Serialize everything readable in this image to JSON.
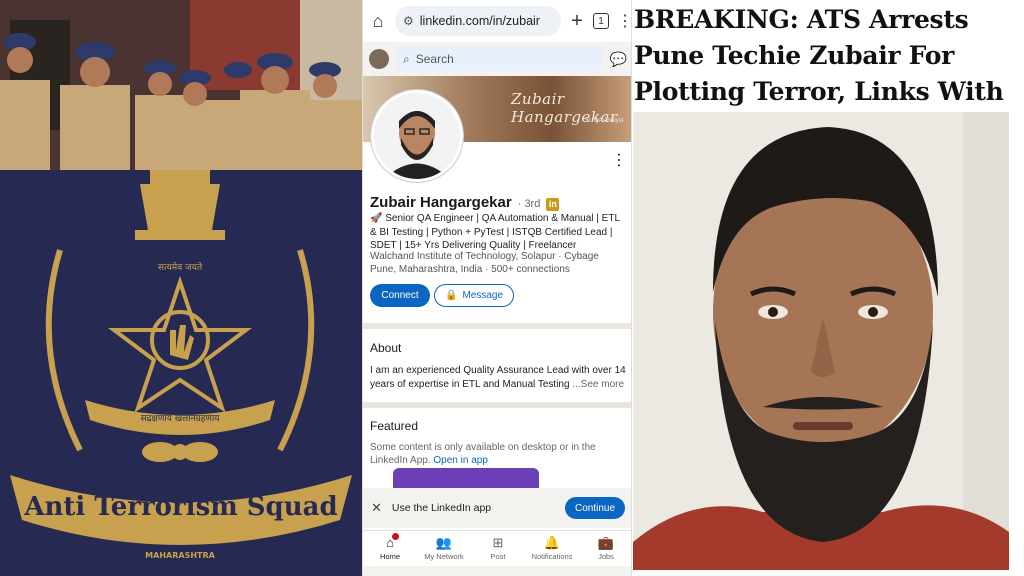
{
  "left": {
    "emblem": {
      "motto": "सत्यमेव जयते",
      "scroll_text": "सद्रक्षणाय खलनिग्रहणाय",
      "banner_text": "Anti Terrorism Squad",
      "state": "MAHARASHTRA"
    }
  },
  "browser": {
    "url": "linkedin.com/in/zubair",
    "tab_count": "1",
    "home_icon": "home-icon",
    "menu_icon": "kebab-icon"
  },
  "linkedin": {
    "search_placeholder": "Search",
    "banner_signature": "Zubair Hangargekar",
    "banner_role": "Sr. QA Analyst",
    "profile": {
      "name": "Zubair Hangargekar",
      "degree": "· 3rd",
      "badge": "in",
      "headline": "🚀 Senior QA Engineer | QA Automation & Manual | ETL & BI Testing | Python + PyTest | ISTQB Certified Lead | SDET | 15+ Yrs Delivering Quality | Freelancer",
      "education_company": "Walchand Institute of Technology, Solapur · Cybage",
      "location_connections": "Pune, Maharashtra, India · 500+ connections"
    },
    "buttons": {
      "connect": "Connect",
      "message": "Message"
    },
    "about": {
      "title": "About",
      "text": "I am an experienced Quality Assurance Lead with over 14 years of expertise in ETL and Manual Testing",
      "see_more": "...See more"
    },
    "featured": {
      "title": "Featured",
      "note": "Some content is only available on desktop or in the LinkedIn App.",
      "open_link": "Open in app"
    },
    "app_banner": {
      "text": "Use the LinkedIn app",
      "continue": "Continue"
    },
    "nav": [
      {
        "label": "Home",
        "icon": "home-icon"
      },
      {
        "label": "My Network",
        "icon": "network-icon"
      },
      {
        "label": "Post",
        "icon": "post-icon"
      },
      {
        "label": "Notifications",
        "icon": "bell-icon"
      },
      {
        "label": "Jobs",
        "icon": "briefcase-icon"
      }
    ]
  },
  "news": {
    "headline": "BREAKING: ATS Arrests Pune Techie Zubair For Plotting Terror, Links With Al Qaeda"
  }
}
